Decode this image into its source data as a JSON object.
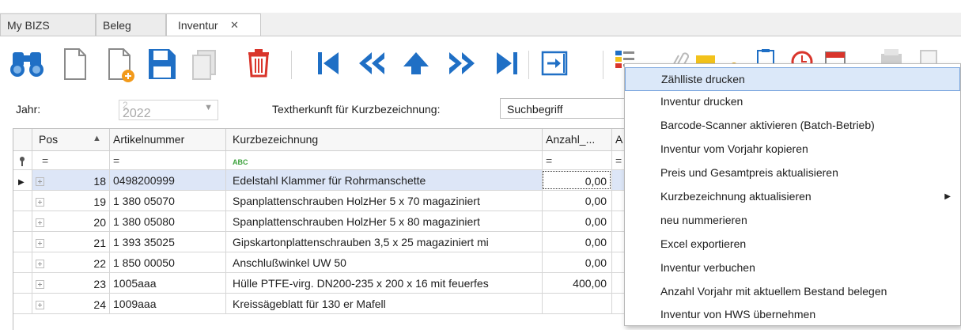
{
  "tabs": [
    {
      "label": "My BIZS",
      "active": false
    },
    {
      "label": "Beleg",
      "active": false
    },
    {
      "label": "Inventur",
      "active": true,
      "close": "✕"
    }
  ],
  "toolbar": {
    "icons": [
      "binoculars-icon",
      "new-document-icon",
      "new-document-add-icon",
      "save-icon",
      "copy-icon",
      "delete-icon",
      "first-record-icon",
      "previous-page-icon",
      "previous-record-icon",
      "next-page-icon",
      "last-record-icon",
      "export-icon",
      "report-menu-icon",
      "attach-icon",
      "note-icon",
      "key-icon",
      "clipboard-icon",
      "alarm-icon",
      "calendar-icon",
      "print-icon",
      "document-icon"
    ],
    "colors": {
      "blue": "#1f6fc5",
      "red": "#d9352b",
      "gray": "#c9c9c9",
      "yellow": "#f2c21b",
      "green": "#3fa33f"
    }
  },
  "filters": {
    "jahr_label": "Jahr:",
    "jahr_value": "2022",
    "jahr_prefix": "2",
    "textherkunft_label": "Textherkunft für Kurzbezeichnung:",
    "textherkunft_value": "Suchbegriff"
  },
  "grid": {
    "columns": [
      "Pos",
      "Artikelnummer",
      "Kurzbezeichnung",
      "Anzahl_...",
      "A"
    ],
    "sort_glyph": "▲",
    "filter_row": {
      "pin": "📌",
      "pos": "=",
      "artikel": "=",
      "kurz": "ABC",
      "anzahl": "=",
      "a": "="
    },
    "rows": [
      {
        "pos": "18",
        "artikel": "0498200999",
        "kurz": "Edelstahl Klammer für Rohrmanschette",
        "anzahl": "0,00",
        "selected": true
      },
      {
        "pos": "19",
        "artikel": "1 380 05070",
        "kurz": "Spanplattenschrauben HolzHer 5 x 70 magaziniert",
        "anzahl": "0,00",
        "selected": false
      },
      {
        "pos": "20",
        "artikel": "1 380 05080",
        "kurz": "Spanplattenschrauben HolzHer 5 x 80 magaziniert",
        "anzahl": "0,00",
        "selected": false
      },
      {
        "pos": "21",
        "artikel": "1 393 35025",
        "kurz": "Gipskartonplattenschrauben 3,5 x 25 magaziniert mi",
        "anzahl": "0,00",
        "selected": false
      },
      {
        "pos": "22",
        "artikel": "1 850 00050",
        "kurz": "Anschlußwinkel UW 50",
        "anzahl": "0,00",
        "selected": false
      },
      {
        "pos": "23",
        "artikel": "1005aaa",
        "kurz": "Hülle PTFE-virg. DN200-235 x 200 x 16 mit feuerfes",
        "anzahl": "400,00",
        "selected": false
      },
      {
        "pos": "24",
        "artikel": "1009aaa",
        "kurz": "Kreissägeblatt für 130 er Mafell",
        "anzahl": "",
        "selected": false
      }
    ]
  },
  "menu": {
    "items": [
      {
        "label": "Zählliste drucken",
        "highlighted": true,
        "submenu": false
      },
      {
        "label": "Inventur drucken",
        "highlighted": false,
        "submenu": false
      },
      {
        "label": "Barcode-Scanner aktivieren (Batch-Betrieb)",
        "highlighted": false,
        "submenu": false
      },
      {
        "label": "Inventur vom Vorjahr kopieren",
        "highlighted": false,
        "submenu": false
      },
      {
        "label": "Preis und Gesamtpreis aktualisieren",
        "highlighted": false,
        "submenu": false
      },
      {
        "label": "Kurzbezeichnung aktualisieren",
        "highlighted": false,
        "submenu": true,
        "submenu_glyph": "▶"
      },
      {
        "label": "neu nummerieren",
        "highlighted": false,
        "submenu": false
      },
      {
        "label": "Excel exportieren",
        "highlighted": false,
        "submenu": false
      },
      {
        "label": "Inventur verbuchen",
        "highlighted": false,
        "submenu": false
      },
      {
        "label": "Anzahl Vorjahr mit aktuellem Bestand belegen",
        "highlighted": false,
        "submenu": false
      },
      {
        "label": "Inventur von HWS übernehmen",
        "highlighted": false,
        "submenu": false
      }
    ]
  }
}
